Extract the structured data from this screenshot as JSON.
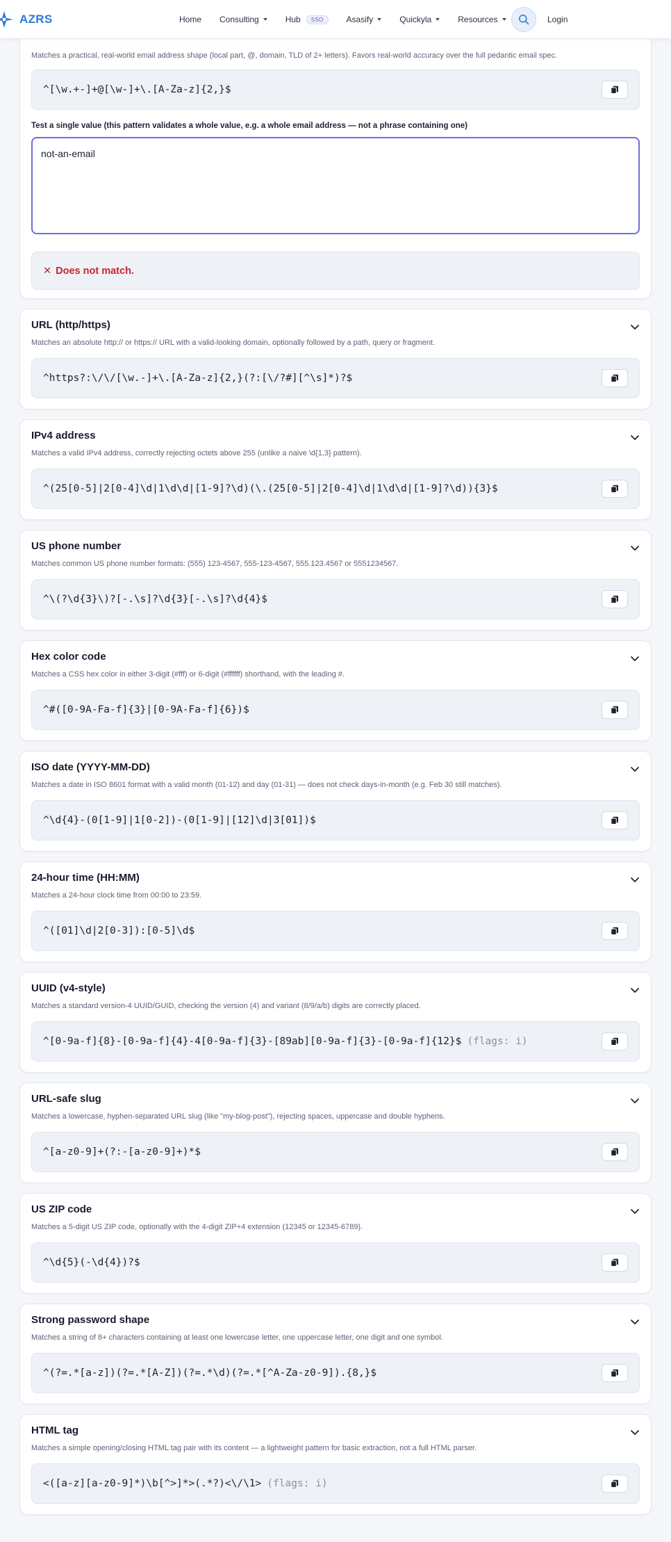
{
  "header": {
    "brand": "AZRS",
    "nav": [
      {
        "label": "Home",
        "dropdown": false
      },
      {
        "label": "Consulting",
        "dropdown": true
      },
      {
        "label": "Hub",
        "dropdown": false,
        "badge": "SSO"
      },
      {
        "label": "Asasify",
        "dropdown": true
      },
      {
        "label": "Quickyla",
        "dropdown": true
      },
      {
        "label": "Resources",
        "dropdown": true
      }
    ],
    "search_icon": "search-icon",
    "login": "Login"
  },
  "email_card": {
    "description": "Matches a practical, real-world email address shape (local part, @, domain, TLD of 2+ letters). Favors real-world accuracy over the full pedantic email spec.",
    "pattern": "^[\\w.+-]+@[\\w-]+\\.[A-Za-z]{2,}$",
    "test_label": "Test a single value (this pattern validates a whole value, e.g. a whole email address — not a phrase containing one)",
    "test_value": "not-an-email",
    "result_icon": "✕",
    "result_text": "Does not match."
  },
  "patterns": [
    {
      "title": "URL (http/https)",
      "description": "Matches an absolute http:// or https:// URL with a valid-looking domain, optionally followed by a path, query or fragment.",
      "pattern": "^https?:\\/\\/[\\w.-]+\\.[A-Za-z]{2,}(?:[\\/?#][^\\s]*)?$",
      "flags": ""
    },
    {
      "title": "IPv4 address",
      "description": "Matches a valid IPv4 address, correctly rejecting octets above 255 (unlike a naive \\d{1,3} pattern).",
      "pattern": "^(25[0-5]|2[0-4]\\d|1\\d\\d|[1-9]?\\d)(\\.(25[0-5]|2[0-4]\\d|1\\d\\d|[1-9]?\\d)){3}$",
      "flags": ""
    },
    {
      "title": "US phone number",
      "description": "Matches common US phone number formats: (555) 123-4567, 555-123-4567, 555.123.4567 or 5551234567.",
      "pattern": "^\\(?\\d{3}\\)?[-.\\s]?\\d{3}[-.\\s]?\\d{4}$",
      "flags": ""
    },
    {
      "title": "Hex color code",
      "description": "Matches a CSS hex color in either 3-digit (#fff) or 6-digit (#ffffff) shorthand, with the leading #.",
      "pattern": "^#([0-9A-Fa-f]{3}|[0-9A-Fa-f]{6})$",
      "flags": ""
    },
    {
      "title": "ISO date (YYYY-MM-DD)",
      "description": "Matches a date in ISO 8601 format with a valid month (01-12) and day (01-31) — does not check days-in-month (e.g. Feb 30 still matches).",
      "pattern": "^\\d{4}-(0[1-9]|1[0-2])-(0[1-9]|[12]\\d|3[01])$",
      "flags": ""
    },
    {
      "title": "24-hour time (HH:MM)",
      "description": "Matches a 24-hour clock time from 00:00 to 23:59.",
      "pattern": "^([01]\\d|2[0-3]):[0-5]\\d$",
      "flags": ""
    },
    {
      "title": "UUID (v4-style)",
      "description": "Matches a standard version-4 UUID/GUID, checking the version (4) and variant (8/9/a/b) digits are correctly placed.",
      "pattern": "^[0-9a-f]{8}-[0-9a-f]{4}-4[0-9a-f]{3}-[89ab][0-9a-f]{3}-[0-9a-f]{12}$",
      "flags": "(flags: i)"
    },
    {
      "title": "URL-safe slug",
      "description": "Matches a lowercase, hyphen-separated URL slug (like \"my-blog-post\"), rejecting spaces, uppercase and double hyphens.",
      "pattern": "^[a-z0-9]+(?:-[a-z0-9]+)*$",
      "flags": ""
    },
    {
      "title": "US ZIP code",
      "description": "Matches a 5-digit US ZIP code, optionally with the 4-digit ZIP+4 extension (12345 or 12345-6789).",
      "pattern": "^\\d{5}(-\\d{4})?$",
      "flags": ""
    },
    {
      "title": "Strong password shape",
      "description": "Matches a string of 8+ characters containing at least one lowercase letter, one uppercase letter, one digit and one symbol.",
      "pattern": "^(?=.*[a-z])(?=.*[A-Z])(?=.*\\d)(?=.*[^A-Za-z0-9]).{8,}$",
      "flags": ""
    },
    {
      "title": "HTML tag",
      "description": "Matches a simple opening/closing HTML tag pair with its content — a lightweight pattern for basic extraction, not a full HTML parser.",
      "pattern": "<([a-z][a-z0-9]*)\\b[^>]*>(.*?)<\\/\\1>",
      "flags": "(flags: i)"
    }
  ],
  "icons": {
    "copy": "copy-icon",
    "chevron": "chevron-down-icon"
  },
  "colors": {
    "accent": "#6b6fe0",
    "brand": "#2f7bd6",
    "error": "#c8262e"
  }
}
